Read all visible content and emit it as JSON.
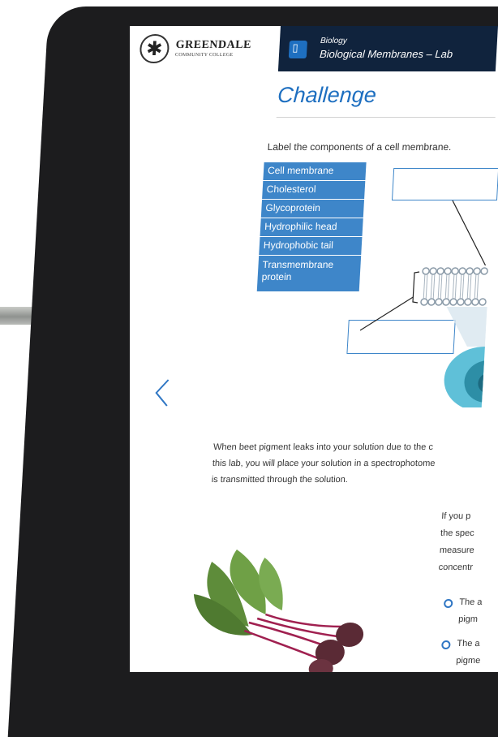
{
  "header": {
    "logo_name": "GREENDALE",
    "logo_sub": "COMMUNITY COLLEGE",
    "course_subtitle": "Biology",
    "lab_title": "Biological Membranes – Lab"
  },
  "challenge": {
    "title": "Challenge",
    "instruction": "Label the components of a cell membrane.",
    "labels": [
      "Cell membrane",
      "Cholesterol",
      "Glycoprotein",
      "Hydrophilic head",
      "Hydrophobic tail",
      "Transmembrane",
      "protein"
    ]
  },
  "paragraph": {
    "line1": "When beet pigment leaks into your solution due to the c",
    "line2": "this lab, you will place your solution in a spectrophotome",
    "line3": "is transmitted through the solution."
  },
  "question": {
    "line1": "If you p",
    "line2": "the spec",
    "line3": "measure",
    "line4": "concentr",
    "option1_line1": "The a",
    "option1_line2": "pigm",
    "option2_line1": "The a",
    "option2_line2": "pigme"
  },
  "colors": {
    "accent": "#1e6fc0",
    "header": "#10233d",
    "chip": "#3e86c9"
  },
  "icons": [
    "seal-logo",
    "book-icon",
    "chevron-left-icon",
    "radio-icon"
  ]
}
